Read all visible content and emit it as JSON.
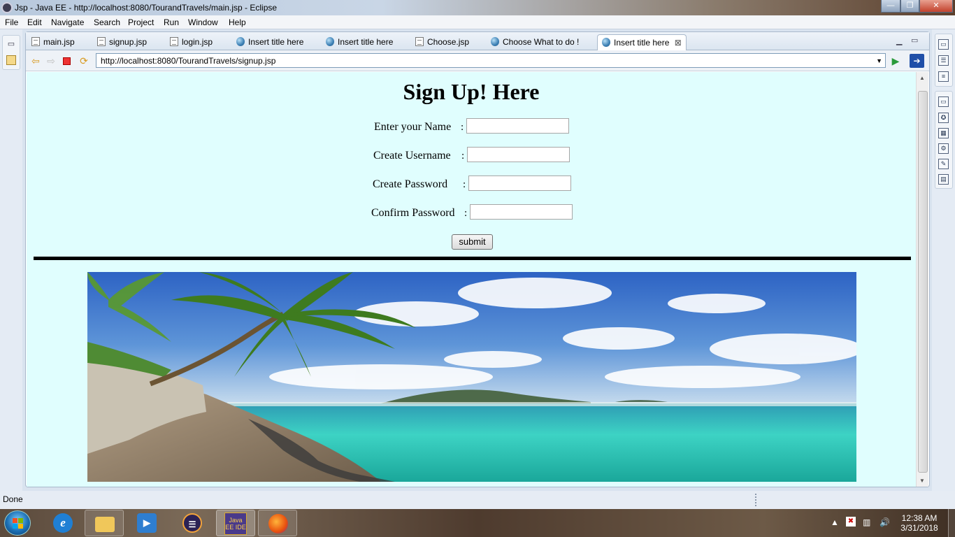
{
  "window": {
    "title": "Jsp - Java EE - http://localhost:8080/TourandTravels/main.jsp - Eclipse",
    "minimize": "—",
    "maximize": "❐",
    "close": "✕"
  },
  "menu": [
    "File",
    "Edit",
    "Navigate",
    "Search",
    "Project",
    "Run",
    "Window",
    "Help"
  ],
  "tabs": [
    {
      "label": "main.jsp",
      "icon": "jsp-file-icon"
    },
    {
      "label": "signup.jsp",
      "icon": "jsp-file-icon"
    },
    {
      "label": "login.jsp",
      "icon": "jsp-file-icon"
    },
    {
      "label": "Insert title here",
      "icon": "web-browser-globe-icon"
    },
    {
      "label": "Insert title here",
      "icon": "web-browser-globe-icon"
    },
    {
      "label": "Choose.jsp",
      "icon": "jsp-file-icon"
    },
    {
      "label": "Choose What to do !",
      "icon": "web-browser-globe-icon"
    },
    {
      "label": "Insert title here",
      "icon": "web-browser-globe-icon",
      "active": true,
      "close": "⊠"
    }
  ],
  "browser": {
    "url": "http://localhost:8080/TourandTravels/signup.jsp"
  },
  "page": {
    "heading": "Sign Up! Here",
    "fields": [
      {
        "label": "Enter your Name",
        "colon": ":",
        "value": ""
      },
      {
        "label": "Create Username",
        "colon": ":",
        "value": ""
      },
      {
        "label": "Create Password",
        "colon": ":",
        "value": ""
      },
      {
        "label": "Confirm Password",
        "colon": ":",
        "value": ""
      }
    ],
    "submit": "submit",
    "image": "tropical-beach-palm-image"
  },
  "status": {
    "text": "Done"
  },
  "taskbar": {
    "items": [
      "start-orb",
      "internet-explorer-icon",
      "file-explorer-icon",
      "media-player-icon",
      "eclipse-icon",
      "java-ee-ide-icon",
      "firefox-icon"
    ],
    "java_ee_label": "Java EE IDE",
    "time": "12:38 AM",
    "date": "3/31/2018"
  },
  "colors": {
    "page_bg": "#e0fefe",
    "accent": "#1b6fb4"
  }
}
